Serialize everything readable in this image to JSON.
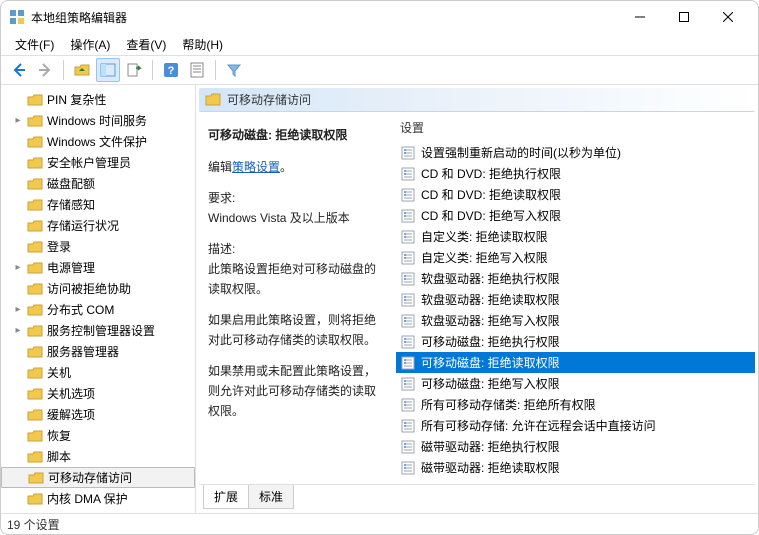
{
  "window": {
    "title": "本地组策略编辑器"
  },
  "menu": {
    "file": "文件(F)",
    "action": "操作(A)",
    "view": "查看(V)",
    "help": "帮助(H)"
  },
  "tree": {
    "items": [
      {
        "label": "PIN 复杂性",
        "expander": ""
      },
      {
        "label": "Windows 时间服务",
        "expander": "▸"
      },
      {
        "label": "Windows 文件保护",
        "expander": ""
      },
      {
        "label": "安全帐户管理员",
        "expander": ""
      },
      {
        "label": "磁盘配额",
        "expander": ""
      },
      {
        "label": "存储感知",
        "expander": ""
      },
      {
        "label": "存储运行状况",
        "expander": ""
      },
      {
        "label": "登录",
        "expander": ""
      },
      {
        "label": "电源管理",
        "expander": "▸"
      },
      {
        "label": "访问被拒绝协助",
        "expander": ""
      },
      {
        "label": "分布式 COM",
        "expander": "▸"
      },
      {
        "label": "服务控制管理器设置",
        "expander": "▸"
      },
      {
        "label": "服务器管理器",
        "expander": ""
      },
      {
        "label": "关机",
        "expander": ""
      },
      {
        "label": "关机选项",
        "expander": ""
      },
      {
        "label": "缓解选项",
        "expander": ""
      },
      {
        "label": "恢复",
        "expander": ""
      },
      {
        "label": "脚本",
        "expander": ""
      },
      {
        "label": "可移动存储访问",
        "expander": "",
        "selected": true
      },
      {
        "label": "内核 DMA 保护",
        "expander": ""
      }
    ]
  },
  "category": {
    "title": "可移动存储访问"
  },
  "description": {
    "title": "可移动磁盘: 拒绝读取权限",
    "edit_prefix": "编辑",
    "edit_link": "策略设置",
    "req_label": "要求:",
    "req_value": "Windows Vista 及以上版本",
    "desc_label": "描述:",
    "desc1": "此策略设置拒绝对可移动磁盘的读取权限。",
    "desc2": "如果启用此策略设置，则将拒绝对此可移动存储类的读取权限。",
    "desc3": "如果禁用或未配置此策略设置，则允许对此可移动存储类的读取权限。"
  },
  "settings": {
    "column": "设置",
    "items": [
      "设置强制重新启动的时间(以秒为单位)",
      "CD 和 DVD: 拒绝执行权限",
      "CD 和 DVD: 拒绝读取权限",
      "CD 和 DVD: 拒绝写入权限",
      "自定义类: 拒绝读取权限",
      "自定义类: 拒绝写入权限",
      "软盘驱动器: 拒绝执行权限",
      "软盘驱动器: 拒绝读取权限",
      "软盘驱动器: 拒绝写入权限",
      "可移动磁盘: 拒绝执行权限",
      "可移动磁盘: 拒绝读取权限",
      "可移动磁盘: 拒绝写入权限",
      "所有可移动存储类: 拒绝所有权限",
      "所有可移动存储: 允许在远程会话中直接访问",
      "磁带驱动器: 拒绝执行权限",
      "磁带驱动器: 拒绝读取权限"
    ],
    "selected_index": 10
  },
  "tabs": {
    "extended": "扩展",
    "standard": "标准"
  },
  "status": "19 个设置"
}
